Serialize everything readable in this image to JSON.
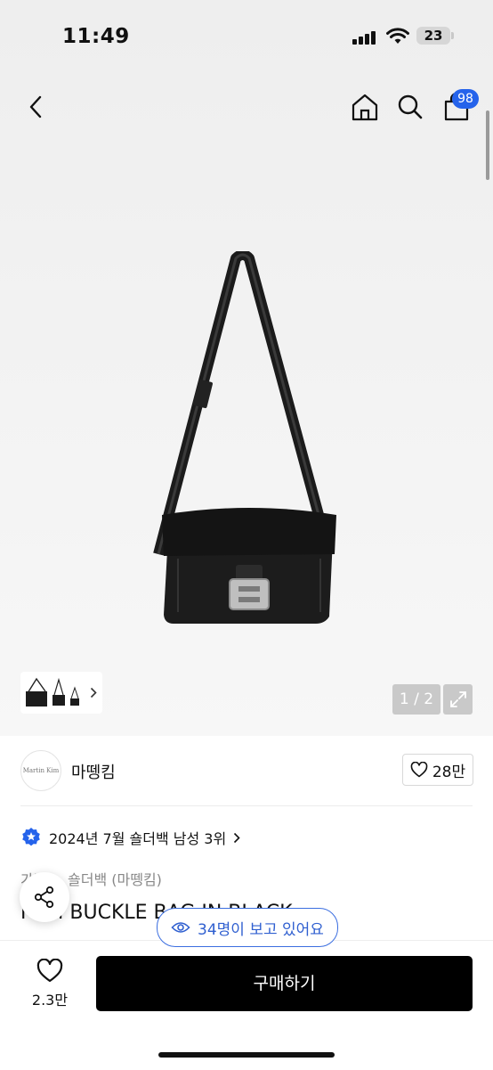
{
  "status_bar": {
    "time": "11:49",
    "battery": "23"
  },
  "header": {
    "cart_count": "98"
  },
  "gallery": {
    "counter": "1 / 2"
  },
  "brand": {
    "logo_text": "Martin Kim",
    "name": "마뗑킴",
    "likes": "28만"
  },
  "product": {
    "ranking": "2024년 7월 숄더백 남성 3위",
    "category": "가방 > 숄더백 (마뗑킴)",
    "title": "MINI BUCKLE BAG IN BLACK"
  },
  "viewers_pill": "34명이 보고 있어요",
  "bottom_bar": {
    "wishlist_count": "2.3만",
    "buy_label": "구매하기"
  },
  "colors": {
    "accent": "#2563eb",
    "buy_button": "#000000"
  },
  "icons": [
    "back-icon",
    "home-icon",
    "search-icon",
    "bag-icon",
    "expand-icon",
    "heart-icon",
    "star-badge-icon",
    "chevron-right-icon",
    "share-icon",
    "eye-icon"
  ]
}
